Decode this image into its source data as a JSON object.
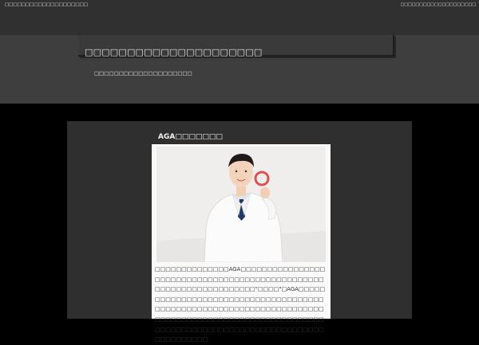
{
  "header": {
    "top_left_text": "□□□□□□□□□□□□□□□□□□□□",
    "top_right_text": "□□□□□□□□□□□□□□□□□□□□"
  },
  "hero": {
    "site_title": "□□□□□□□□□□□□□□□□□□□□□",
    "tagline": "□□□□□□□□□□□□□□□□□□□□"
  },
  "post": {
    "title": "AGA□□□□□□□",
    "image_icon": "doctor-ok-sign-photo",
    "body": "□□□□□□□□□□□□□□AGA□□□□□□□□□□□□□□□□□□□□□□□□□□□□□□□□□□□□□□□□□□□□□□□□□□□□□□□□□□□□□□□□□□□\"□□□□\"□AGA□□□□□□□□□□□□□□□□□□□□□□□□□□□□□□□□□□□□□□□□□□□□□□□□□□□□□□□□□□□□□□□□□□□□□□□□□□□□□□□□□□□□□□□□□□□□□□□□□□□□□□□□□□□□□□□□□□□□□□□□□□□□□□□□□□□□□□□□□□□□□□□"
  },
  "colors": {
    "page_bg": "#000000",
    "topbar_bg": "#303030",
    "hero_bg": "#3e3e3e",
    "content_bg": "#2f2f2f",
    "card_bg": "#fafafa",
    "ok_ring": "#e05252"
  }
}
